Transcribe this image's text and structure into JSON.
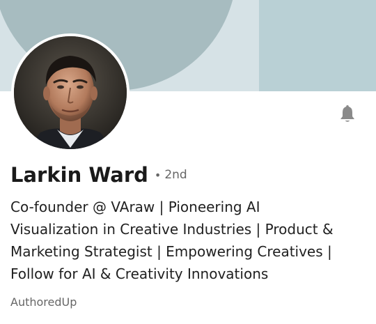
{
  "profile": {
    "name": "Larkin Ward",
    "separator": "•",
    "connection_degree": "2nd",
    "headline": "Co-founder @ VAraw | Pioneering AI\nVisualization in Creative Industries | Product &\nMarketing Strategist | Empowering Creatives |\nFollow for AI & Creativity Innovations",
    "source": "AuthoredUp"
  },
  "icons": {
    "notification": "bell-icon",
    "avatar": "profile-photo"
  },
  "colors": {
    "banner_base": "#d6e2e6",
    "banner_shape_left": "#a7bcc0",
    "banner_shape_right": "#b9d0d5",
    "bell": "#8a8a8a",
    "name": "#1a1a1a",
    "muted": "#666666"
  }
}
